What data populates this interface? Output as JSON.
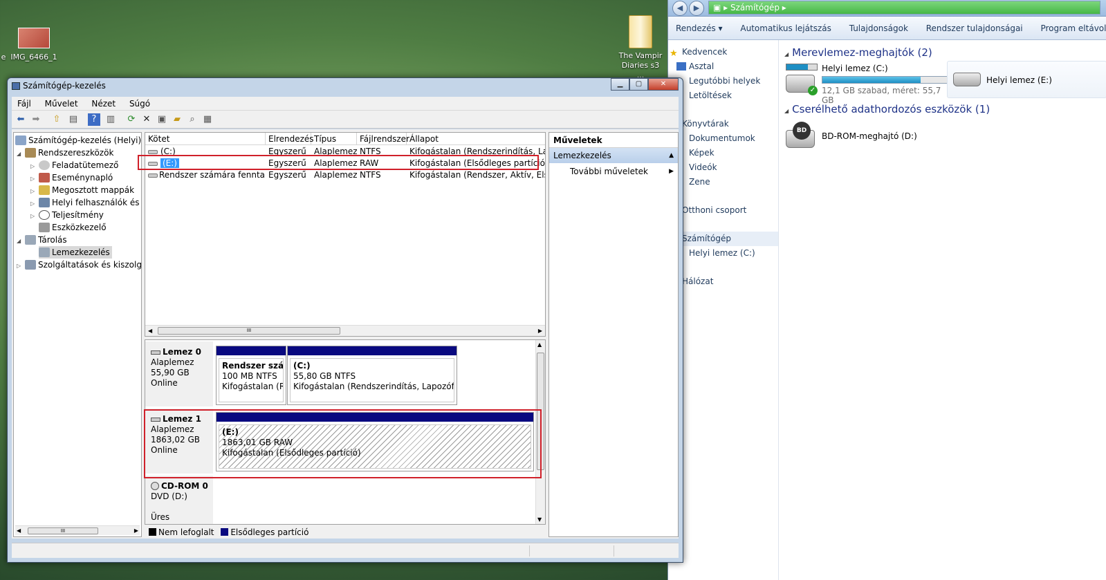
{
  "desktop": {
    "icon1": "IMG_6466_1",
    "icon0_partial": "e",
    "icon2": "The Vampir Diaries s3 ..."
  },
  "explorer": {
    "address": "Számítógép",
    "toolbar": [
      "Rendezés ▾",
      "Automatikus lejátszás",
      "Tulajdonságok",
      "Rendszer tulajdonságai",
      "Program eltávolítása v"
    ],
    "nav": [
      "Kedvencek",
      "Asztal",
      "Legutóbbi helyek",
      "Letöltések",
      "Könyvtárak",
      "Dokumentumok",
      "Képek",
      "Videók",
      "Zene",
      "Otthoni csoport",
      "Számítógép",
      "Helyi lemez (C:)",
      "Hálózat"
    ],
    "hdd_group": "Merevlemez-meghajtók (2)",
    "c_name": "Helyi lemez (C:)",
    "c_info": "12,1 GB szabad, méret: 55,7 GB",
    "c_used_fraction": 0.78,
    "e_name": "Helyi lemez (E:)",
    "removable_group": "Cserélhető adathordozós eszközök (1)",
    "bd_name": "BD-ROM-meghajtó (D:)",
    "bd_label": "BD"
  },
  "window": {
    "title": "Számítógép-kezelés",
    "menu": [
      "Fájl",
      "Művelet",
      "Nézet",
      "Súgó"
    ],
    "tree": [
      "Számítógép-kezelés (Helyi)",
      "Rendszereszközök",
      "Feladatütemező",
      "Eseménynapló",
      "Megosztott mappák",
      "Helyi felhasználók és cs",
      "Teljesítmény",
      "Eszközkezelő",
      "Tárolás",
      "Lemezkezelés",
      "Szolgáltatások és kiszolgáló"
    ],
    "tree_scroll": "III",
    "columns": [
      "Kötet",
      "Elrendezés",
      "Típus",
      "Fájlrendszer",
      "Állapot"
    ],
    "volumes": [
      [
        "(C:)",
        "Egyszerű",
        "Alaplemez",
        "NTFS",
        "Kifogástalan (Rendszerindítás, Lapozóf"
      ],
      [
        "(E:)",
        "Egyszerű",
        "Alaplemez",
        "RAW",
        "Kifogástalan (Elsődleges partíció)"
      ],
      [
        "Rendszer számára fenntartott",
        "Egyszerű",
        "Alaplemez",
        "NTFS",
        "Kifogástalan (Rendszer, Aktív, Elsődleg"
      ]
    ],
    "disks": [
      {
        "name": "Lemez 0",
        "type": "Alaplemez",
        "size": "55,90 GB",
        "status": "Online"
      },
      {
        "name": "Lemez 1",
        "type": "Alaplemez",
        "size": "1863,02 GB",
        "status": "Online"
      },
      {
        "name": "CD-ROM 0",
        "type": "DVD (D:)",
        "size": "",
        "status": "Üres"
      }
    ],
    "parts": [
      {
        "title": "Rendszer számá",
        "l1": "100 MB NTFS",
        "l2": "Kifogástalan (Rer"
      },
      {
        "title": "(C:)",
        "l1": "55,80 GB NTFS",
        "l2": "Kifogástalan (Rendszerindítás, Lapozófájl, Ös"
      },
      {
        "title": "(E:)",
        "l1": "1863,01 GB RAW",
        "l2": "Kifogástalan (Elsődleges partíció)"
      }
    ],
    "legend": [
      "Nem lefoglalt",
      "Elsődleges partíció"
    ],
    "actions": {
      "header": "Műveletek",
      "section": "Lemezkezelés",
      "more": "További műveletek"
    }
  },
  "colors": {
    "primary_partition": "#0a0a80",
    "highlight": "#d0202a",
    "selection": "#3399ff"
  }
}
